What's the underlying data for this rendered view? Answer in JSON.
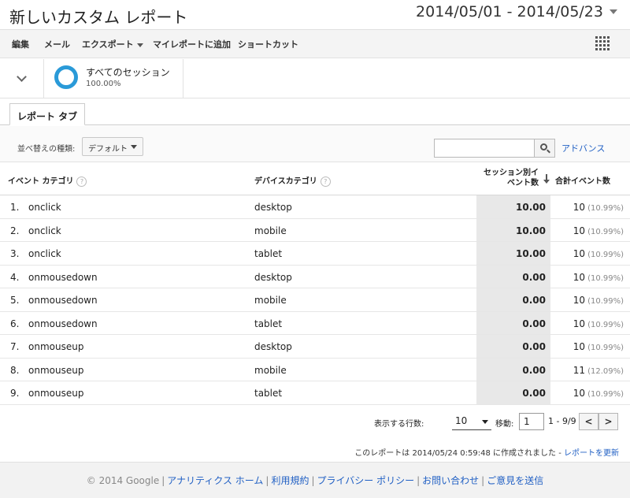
{
  "header": {
    "title": "新しいカスタム レポート",
    "date_range": "2014/05/01 - 2014/05/23"
  },
  "toolbar": {
    "edit": "編集",
    "mail": "メール",
    "export": "エクスポート",
    "add_to_dashboard": "マイレポートに追加",
    "shortcut": "ショートカット"
  },
  "segment": {
    "name": "すべてのセッション",
    "percent": "100.00%"
  },
  "tabs": {
    "report_tab": "レポート タブ"
  },
  "filter": {
    "sort_label": "並べ替えの種類:",
    "sort_value": "デフォルト",
    "search_placeholder": "",
    "advanced": "アドバンス"
  },
  "table": {
    "headers": {
      "event_category": "イベント カテゴリ",
      "device_category": "デバイスカテゴリ",
      "events_per_session_line1": "セッション別イ",
      "events_per_session_line2": "ベント数",
      "total_events": "合計イベント数",
      "help": "?"
    },
    "rows": [
      {
        "idx": "1.",
        "event": "onclick",
        "device": "desktop",
        "value": "10.00",
        "total": "10",
        "pct": "(10.99%)"
      },
      {
        "idx": "2.",
        "event": "onclick",
        "device": "mobile",
        "value": "10.00",
        "total": "10",
        "pct": "(10.99%)"
      },
      {
        "idx": "3.",
        "event": "onclick",
        "device": "tablet",
        "value": "10.00",
        "total": "10",
        "pct": "(10.99%)"
      },
      {
        "idx": "4.",
        "event": "onmousedown",
        "device": "desktop",
        "value": "0.00",
        "total": "10",
        "pct": "(10.99%)"
      },
      {
        "idx": "5.",
        "event": "onmousedown",
        "device": "mobile",
        "value": "0.00",
        "total": "10",
        "pct": "(10.99%)"
      },
      {
        "idx": "6.",
        "event": "onmousedown",
        "device": "tablet",
        "value": "0.00",
        "total": "10",
        "pct": "(10.99%)"
      },
      {
        "idx": "7.",
        "event": "onmouseup",
        "device": "desktop",
        "value": "0.00",
        "total": "10",
        "pct": "(10.99%)"
      },
      {
        "idx": "8.",
        "event": "onmouseup",
        "device": "mobile",
        "value": "0.00",
        "total": "11",
        "pct": "(12.09%)"
      },
      {
        "idx": "9.",
        "event": "onmouseup",
        "device": "tablet",
        "value": "0.00",
        "total": "10",
        "pct": "(10.99%)"
      }
    ]
  },
  "pager": {
    "rows_label": "表示する行数:",
    "rows_value": "10",
    "goto_label": "移動:",
    "goto_value": "1",
    "range": "1 - 9/9",
    "prev": "<",
    "next": ">"
  },
  "stamp": {
    "text": "このレポートは 2014/05/24 0:59:48 に作成されました - ",
    "refresh": "レポートを更新"
  },
  "footer": {
    "copyright": "© 2014 Google",
    "links": [
      "アナリティクス ホーム",
      "利用規約",
      "プライバシー ポリシー",
      "お問い合わせ",
      "ご意見を送信"
    ]
  }
}
